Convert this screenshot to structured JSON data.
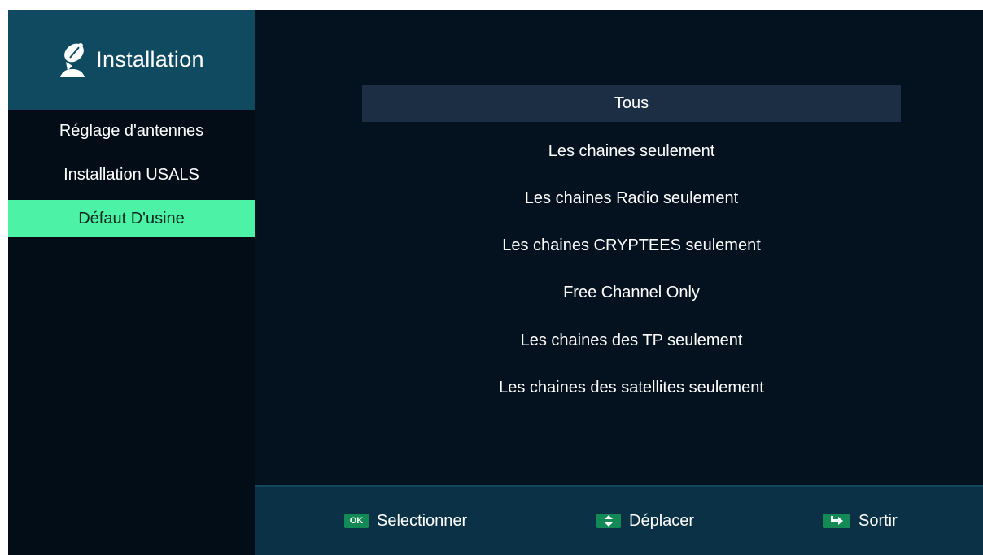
{
  "sidebar": {
    "title": "Installation",
    "icon": "satellite-dish-icon",
    "items": [
      {
        "label": "Réglage d'antennes"
      },
      {
        "label": "Installation USALS"
      },
      {
        "label": "Défaut D'usine"
      }
    ],
    "active_index": 2
  },
  "main": {
    "options": [
      {
        "label": "Tous"
      },
      {
        "label": "Les chaines seulement"
      },
      {
        "label": "Les chaines Radio seulement"
      },
      {
        "label": "Les chaines CRYPTEES seulement"
      },
      {
        "label": "Free Channel Only"
      },
      {
        "label": "Les chaines des TP seulement"
      },
      {
        "label": "Les chaines des satellites seulement"
      }
    ],
    "selected_index": 0
  },
  "footer": {
    "ok": {
      "key": "OK",
      "label": "Selectionner"
    },
    "move": {
      "key": "up-down-arrows-icon",
      "label": "Déplacer"
    },
    "exit": {
      "key": "exit-arrow-icon",
      "label": "Sortir"
    }
  },
  "colors": {
    "background": "#04121f",
    "header": "#0f4a60",
    "active_item": "#4cf2a5",
    "selected_option": "#1c2e44",
    "footer": "#0b3146",
    "key_badge": "#138a55"
  }
}
